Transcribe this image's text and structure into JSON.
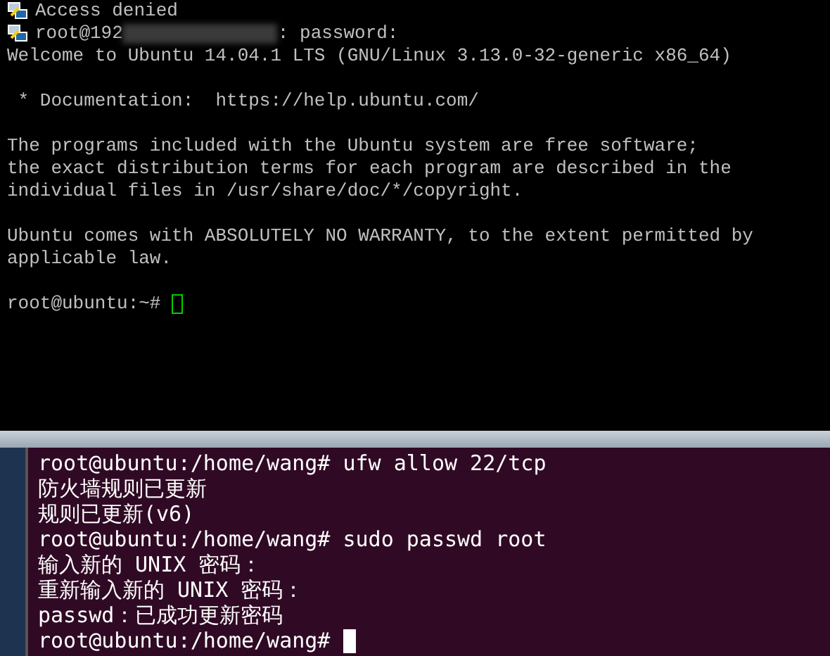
{
  "top_terminal": {
    "lines": [
      {
        "kind": "icon_text",
        "text": "Access denied"
      },
      {
        "kind": "login",
        "prefix": "root@192",
        "suffix": ": password:"
      },
      {
        "kind": "text",
        "text": "Welcome to Ubuntu 14.04.1 LTS (GNU/Linux 3.13.0-32-generic x86_64)"
      },
      {
        "kind": "blank"
      },
      {
        "kind": "text",
        "text": " * Documentation:  https://help.ubuntu.com/"
      },
      {
        "kind": "blank"
      },
      {
        "kind": "text",
        "text": "The programs included with the Ubuntu system are free software;"
      },
      {
        "kind": "text",
        "text": "the exact distribution terms for each program are described in the"
      },
      {
        "kind": "text",
        "text": "individual files in /usr/share/doc/*/copyright."
      },
      {
        "kind": "blank"
      },
      {
        "kind": "text",
        "text": "Ubuntu comes with ABSOLUTELY NO WARRANTY, to the extent permitted by"
      },
      {
        "kind": "text",
        "text": "applicable law."
      },
      {
        "kind": "blank"
      },
      {
        "kind": "prompt",
        "text": "root@ubuntu:~#"
      }
    ]
  },
  "bottom_terminal": {
    "lines": [
      {
        "kind": "text",
        "text": "root@ubuntu:/home/wang# ufw allow 22/tcp"
      },
      {
        "kind": "text",
        "text": "防火墙规则已更新"
      },
      {
        "kind": "text",
        "text": "规则已更新(v6)"
      },
      {
        "kind": "text",
        "text": "root@ubuntu:/home/wang# sudo passwd root"
      },
      {
        "kind": "text",
        "text": "输入新的 UNIX 密码："
      },
      {
        "kind": "text",
        "text": "重新输入新的 UNIX 密码："
      },
      {
        "kind": "text",
        "text": "passwd：已成功更新密码"
      },
      {
        "kind": "prompt",
        "text": "root@ubuntu:/home/wang#"
      }
    ]
  }
}
